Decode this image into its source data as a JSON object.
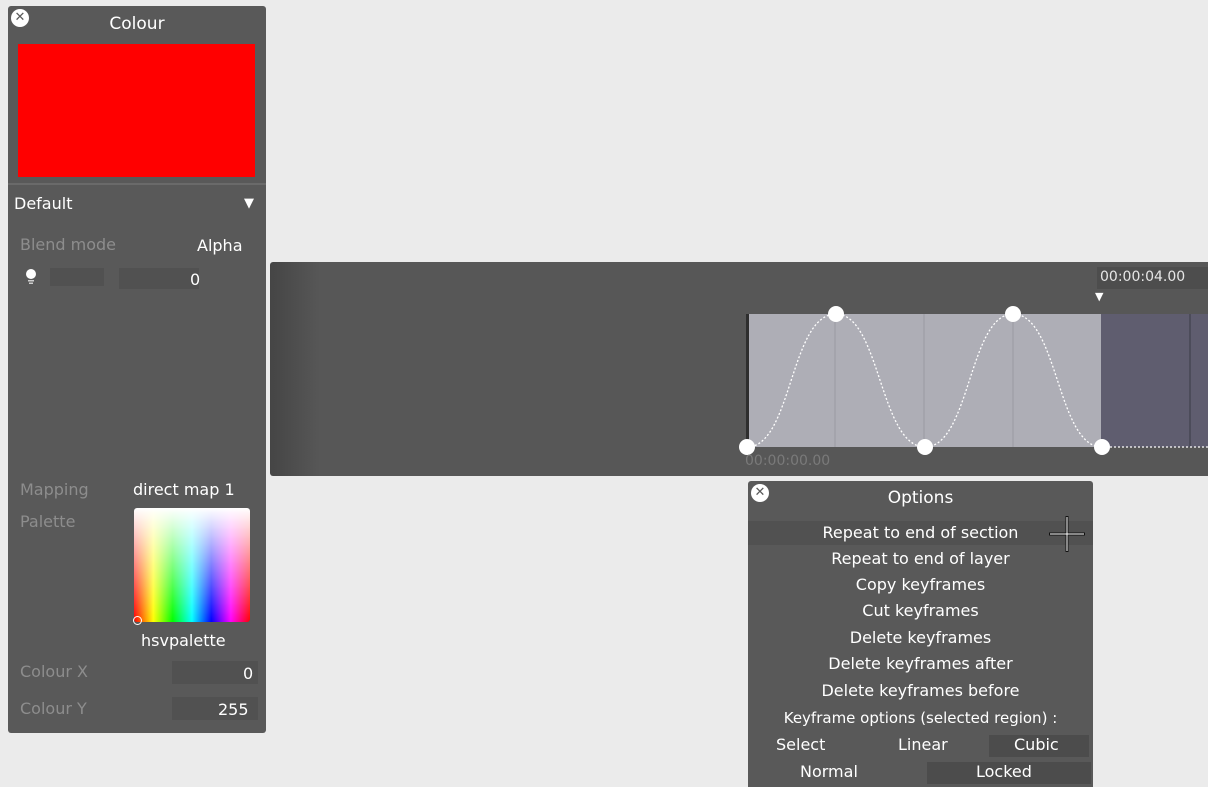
{
  "colour_panel": {
    "title": "Colour",
    "swatch_color": "#ff0000",
    "preset": "Default",
    "blend_mode_label": "Blend mode",
    "blend_mode_value": "Alpha",
    "brightness_value": "0",
    "mapping_label": "Mapping",
    "mapping_value": "direct map 1",
    "palette_label": "Palette",
    "palette_name": "hsvpalette",
    "colour_x_label": "Colour X",
    "colour_x_value": "0",
    "colour_y_label": "Colour Y",
    "colour_y_value": "255"
  },
  "timeline": {
    "end_time": "00:00:04.00",
    "start_time": "00:00:00.00",
    "region_color": "#aeaeb6",
    "after_region_color": "#5f5d6f"
  },
  "options_menu": {
    "title": "Options",
    "items": [
      "Repeat to end of section",
      "Repeat to end of layer",
      "Copy keyframes",
      "Cut keyframes",
      "Delete keyframes",
      "Delete keyframes after",
      "Delete keyframes before"
    ],
    "keyframe_options_label": "Keyframe options (selected region) :",
    "select_label": "Select",
    "linear_label": "Linear",
    "cubic_label": "Cubic",
    "normal_label": "Normal",
    "locked_label": "Locked"
  }
}
